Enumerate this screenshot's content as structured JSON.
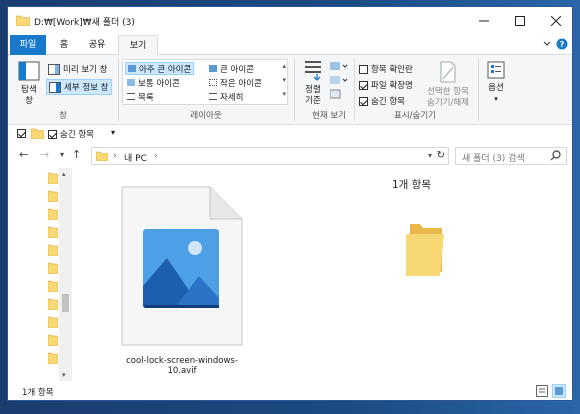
{
  "window": {
    "title": "D:₩[Work]₩새 폴더 (3)"
  },
  "tabs": [
    {
      "label": "파일"
    },
    {
      "label": "홈"
    },
    {
      "label": "공유"
    },
    {
      "label": "보기"
    }
  ],
  "ribbon": {
    "panes": {
      "nav_pane_label_1": "탐색",
      "nav_pane_label_2": "창",
      "preview_pane": "미리 보기 창",
      "details_pane": "세부 정보 창",
      "group_label": "창"
    },
    "layout": {
      "items": [
        "아주 큰 아이콘",
        "큰 아이콘",
        "보통 아이콘",
        "작은 아이콘",
        "목록",
        "자세히"
      ],
      "group_label": "레이아웃"
    },
    "current_view": {
      "sort_label_1": "정렬",
      "sort_label_2": "기준",
      "group_label": "현재 보기"
    },
    "show_hide": {
      "item_checkboxes": "항목 확인란",
      "file_extensions": "파일 확장명",
      "hidden_items": "숨긴 항목",
      "hide_selected_1": "선택한 항목",
      "hide_selected_2": "숨기기/해제",
      "group_label": "표시/숨기기",
      "item_checkboxes_checked": false,
      "file_extensions_checked": true,
      "hidden_items_checked": true
    },
    "options": {
      "label": "옵션"
    }
  },
  "quick_access": {
    "hidden_items": "숨긴 항목",
    "hidden_items_checked": true
  },
  "address": {
    "crumb": "내 PC",
    "separator": "›"
  },
  "search": {
    "placeholder": "새 폴더 (3) 검색"
  },
  "content": {
    "file_name": "cool-lock-screen-windows-10.avif",
    "preview_count": "1개 항목"
  },
  "status": {
    "item_count": "1개 항목"
  },
  "colors": {
    "accent": "#1979ca",
    "folder": "#f8d775",
    "selection": "#cce8ff"
  }
}
